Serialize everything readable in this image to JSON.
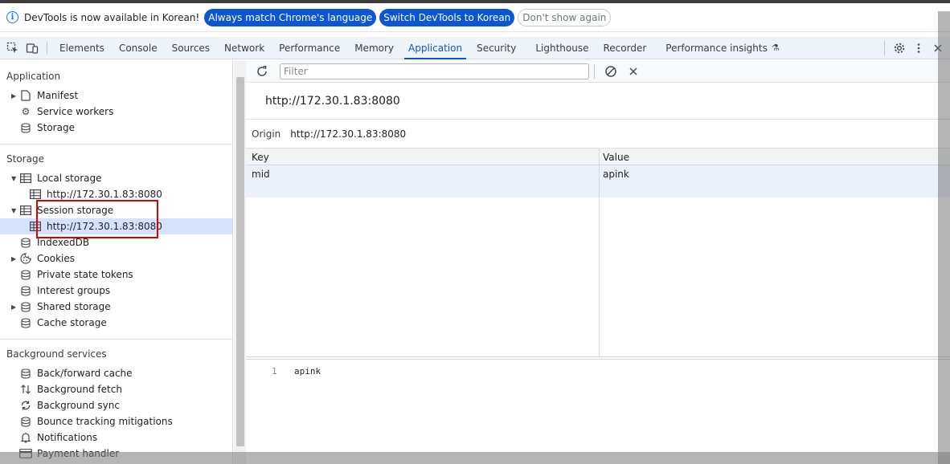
{
  "infobar": {
    "message": "DevTools is now available in Korean!",
    "btn_match": "Always match Chrome's language",
    "btn_switch": "Switch DevTools to Korean",
    "btn_dismiss": "Don't show again"
  },
  "tabs": {
    "elements": "Elements",
    "console": "Console",
    "sources": "Sources",
    "network": "Network",
    "performance": "Performance",
    "memory": "Memory",
    "application": "Application",
    "security": "Security",
    "lighthouse": "Lighthouse",
    "recorder": "Recorder",
    "perf_insights": "Performance insights",
    "active": "Application"
  },
  "sidebar": {
    "application_title": "Application",
    "manifest": "Manifest",
    "service_workers": "Service workers",
    "storage_app": "Storage",
    "storage_title": "Storage",
    "local_storage": "Local storage",
    "local_origin": "http://172.30.1.83:8080",
    "session_storage": "Session storage",
    "session_origin": "http://172.30.1.83:8080",
    "indexeddb": "IndexedDB",
    "cookies": "Cookies",
    "private_state_tokens": "Private state tokens",
    "interest_groups": "Interest groups",
    "shared_storage": "Shared storage",
    "cache_storage": "Cache storage",
    "background_title": "Background services",
    "bfcache": "Back/forward cache",
    "bg_fetch": "Background fetch",
    "bg_sync": "Background sync",
    "bounce": "Bounce tracking mitigations",
    "notifications": "Notifications",
    "payment": "Payment handler"
  },
  "main": {
    "filter_placeholder": "Filter",
    "origin_header": "http://172.30.1.83:8080",
    "origin_label": "Origin",
    "origin_value": "http://172.30.1.83:8080",
    "col_key": "Key",
    "col_value": "Value",
    "rows": [
      {
        "key": "mid",
        "value": "apink"
      }
    ],
    "preview_line": "1",
    "preview_value": "apink"
  },
  "colors": {
    "accent": "#0b57d0",
    "highlight_box": "#e00000",
    "selected_bg": "#d3e3fd"
  }
}
